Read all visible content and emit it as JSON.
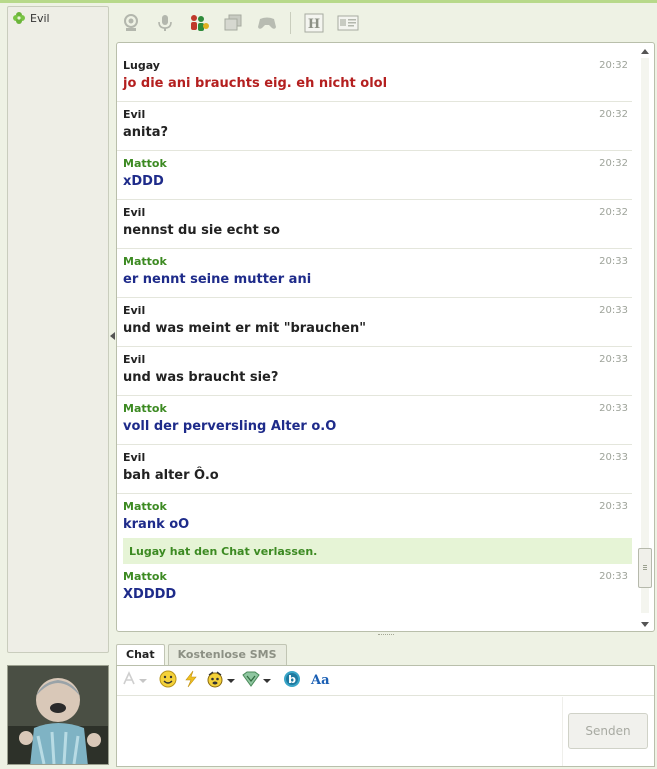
{
  "contacts": [
    {
      "name": "Evil",
      "icon": "clover-status-icon",
      "status_color": "#6bb43a"
    }
  ],
  "toolbar": {
    "icons": [
      "webcam-icon",
      "microphone-icon",
      "add-people-icon",
      "windows-icon",
      "gamepad-icon",
      "history-icon",
      "profile-card-icon"
    ],
    "history_letter": "H"
  },
  "messages": [
    {
      "sender": "Lugay",
      "text": "jo die ani brauchts eig. eh nicht olol",
      "time": "20:32",
      "sender_color": "#222222",
      "text_color": "#b41f1f"
    },
    {
      "sender": "Evil",
      "text": "anita?",
      "time": "20:32",
      "sender_color": "#222222",
      "text_color": "#222222"
    },
    {
      "sender": "Mattok",
      "text": "xDDD",
      "time": "20:32",
      "sender_color": "#3c8a22",
      "text_color": "#1e2b8a"
    },
    {
      "sender": "Evil",
      "text": "nennst du sie echt so",
      "time": "20:32",
      "sender_color": "#222222",
      "text_color": "#222222"
    },
    {
      "sender": "Mattok",
      "text": "er nennt seine mutter ani",
      "time": "20:33",
      "sender_color": "#3c8a22",
      "text_color": "#1e2b8a"
    },
    {
      "sender": "Evil",
      "text": "und was meint er mit \"brauchen\"",
      "time": "20:33",
      "sender_color": "#222222",
      "text_color": "#222222"
    },
    {
      "sender": "Evil",
      "text": "und was braucht sie?",
      "time": "20:33",
      "sender_color": "#222222",
      "text_color": "#222222"
    },
    {
      "sender": "Mattok",
      "text": "voll der perversling Alter o.O",
      "time": "20:33",
      "sender_color": "#3c8a22",
      "text_color": "#1e2b8a"
    },
    {
      "sender": "Evil",
      "text": "bah alter Ô.o",
      "time": "20:33",
      "sender_color": "#222222",
      "text_color": "#222222"
    },
    {
      "sender": "Mattok",
      "text": "krank oO",
      "time": "20:33",
      "sender_color": "#3c8a22",
      "text_color": "#1e2b8a"
    }
  ],
  "system_message": "Lugay hat den Chat verlassen.",
  "last_message": {
    "sender": "Mattok",
    "text": "XDDDD",
    "time": "20:33",
    "sender_color": "#3c8a22",
    "text_color": "#1e2b8a"
  },
  "tabs": [
    {
      "label": "Chat",
      "active": true
    },
    {
      "label": "Kostenlose SMS",
      "active": false
    }
  ],
  "composer": {
    "input_value": "",
    "send_label": "Senden",
    "format_icons": [
      "font-color-icon",
      "smiley-icon",
      "nudge-lightning-icon",
      "animated-emoticon-icon",
      "wink-icon",
      "bing-search-icon",
      "font-style-icon"
    ],
    "font_style_label": "Aa",
    "bing_letter": "b"
  }
}
